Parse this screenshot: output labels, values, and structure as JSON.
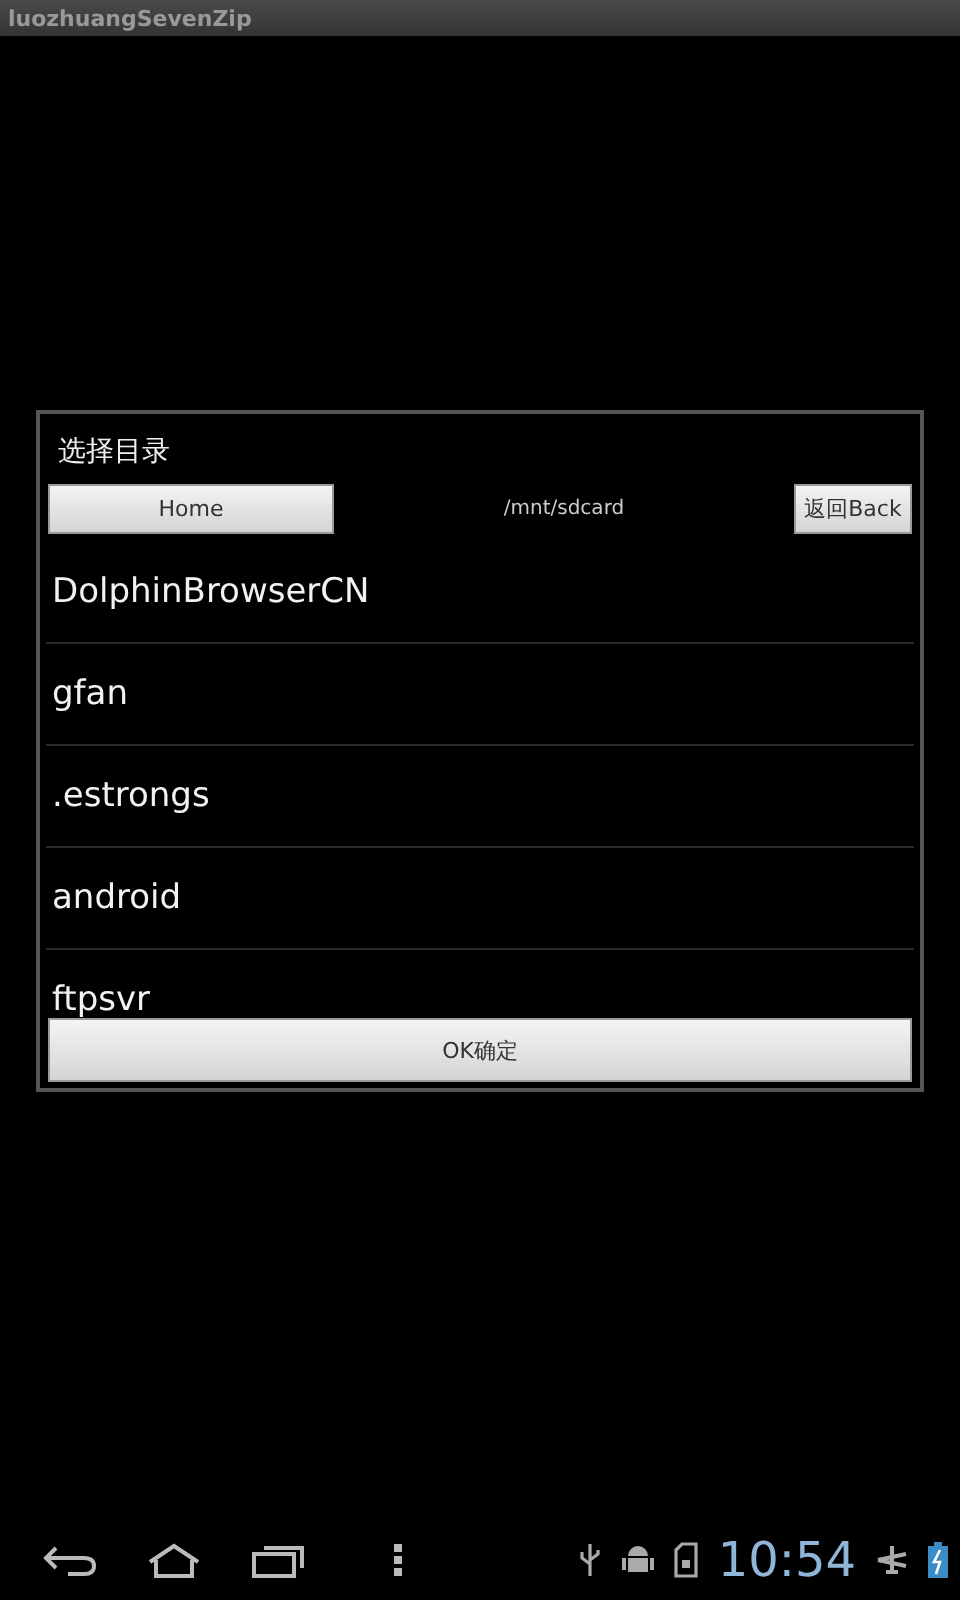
{
  "window": {
    "title": "luozhuangSevenZip"
  },
  "dialog": {
    "title": "选择目录",
    "home_button": "Home",
    "path": "/mnt/sdcard",
    "back_button": "返回Back",
    "folders": [
      {
        "name": "DolphinBrowserCN"
      },
      {
        "name": "gfan"
      },
      {
        "name": ".estrongs"
      },
      {
        "name": "android"
      },
      {
        "name": "ftpsvr"
      }
    ],
    "ok_button": "OK确定"
  },
  "status_bar": {
    "time": "10:54"
  }
}
